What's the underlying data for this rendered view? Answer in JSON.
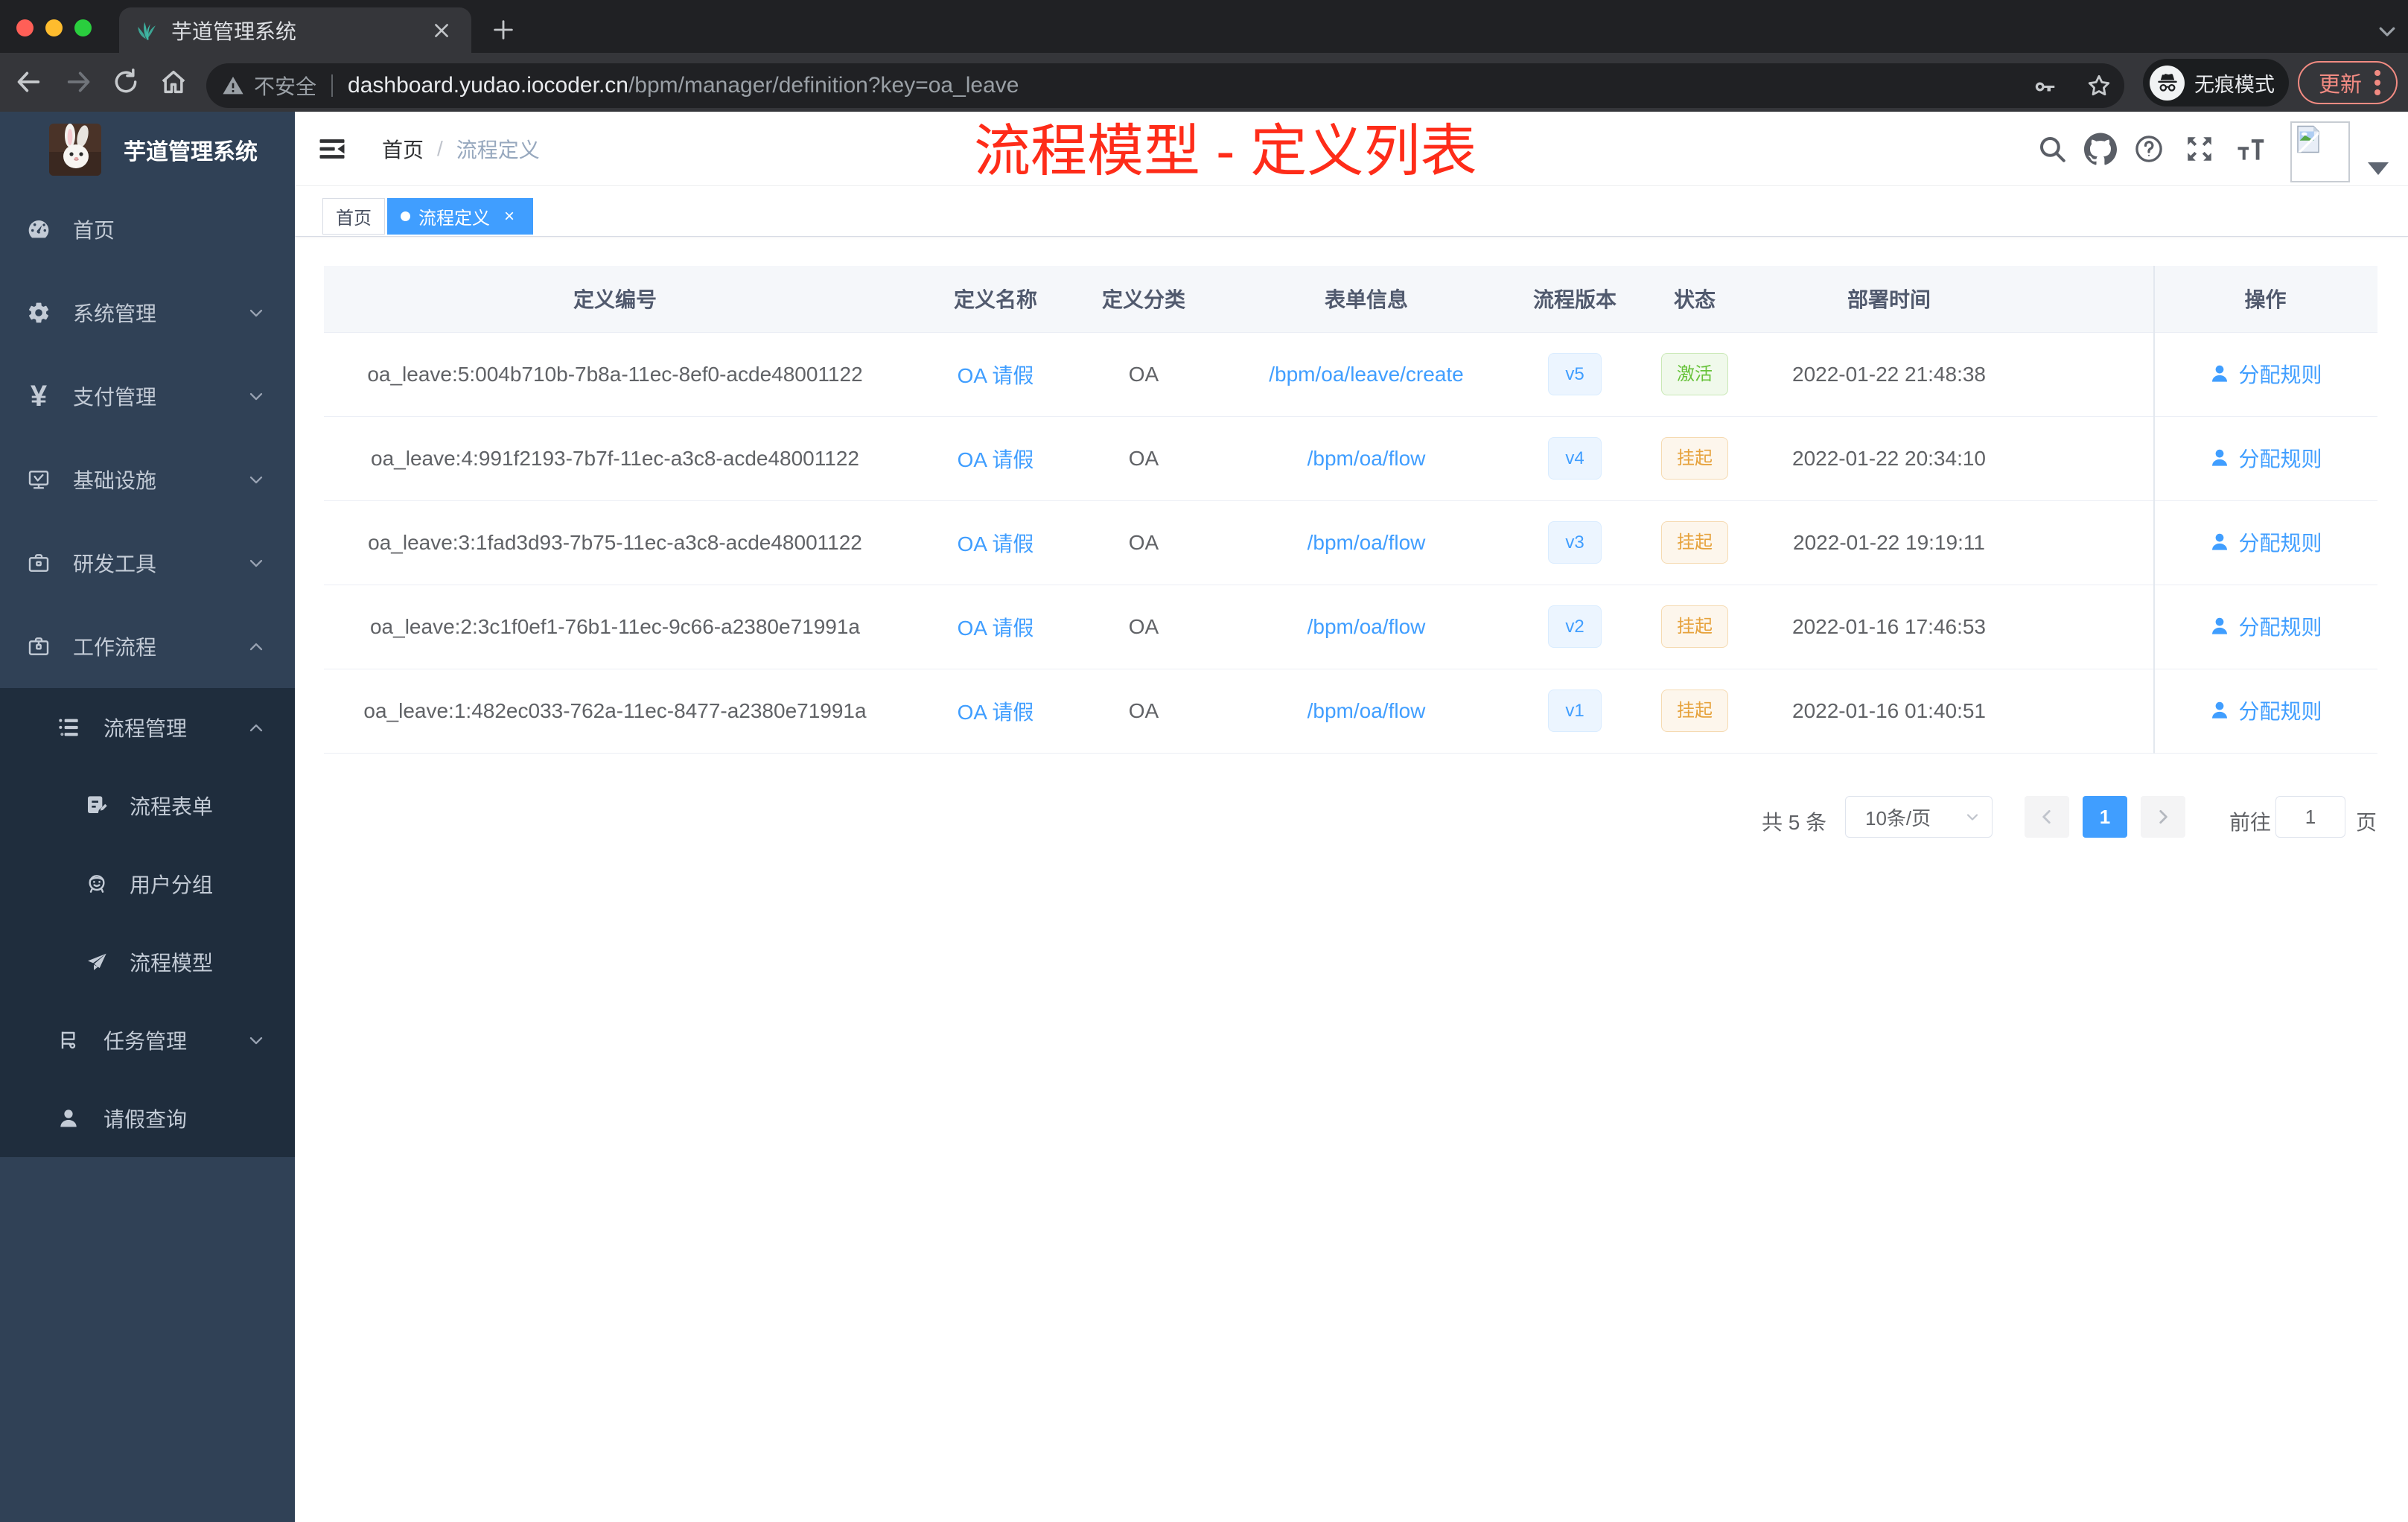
{
  "colors": {
    "accent": "#409eff",
    "success": "#67c23a",
    "warning": "#e6a23c",
    "annotation_red": "#fe2c19",
    "sidebar_bg": "#304156",
    "submenu_bg": "#1f2d3d",
    "update_pill": "#f28b82"
  },
  "browser": {
    "tab_title": "芋道管理系统",
    "new_tab": "+",
    "close_tab": "×",
    "url": {
      "security_label": "不安全",
      "domain": "dashboard.yudao.iocoder.cn",
      "path": "/bpm/manager/definition?key=oa_leave"
    },
    "incognito_label": "无痕模式",
    "update_label": "更新"
  },
  "sidebar": {
    "logo_title": "芋道管理系统",
    "menu": [
      {
        "label": "首页",
        "icon": "dashboard-icon"
      },
      {
        "label": "系统管理",
        "icon": "gear-icon",
        "arrow": "down"
      },
      {
        "label": "支付管理",
        "icon": "yen-icon",
        "arrow": "down",
        "icon_glyph": "¥"
      },
      {
        "label": "基础设施",
        "icon": "monitor-icon",
        "arrow": "down"
      },
      {
        "label": "研发工具",
        "icon": "toolbox-icon",
        "arrow": "down"
      },
      {
        "label": "工作流程",
        "icon": "workflow-icon",
        "arrow": "up"
      }
    ],
    "submenu": [
      {
        "label": "流程管理",
        "icon": "tree-table-icon",
        "arrow": "up",
        "level": 1
      },
      {
        "label": "流程表单",
        "icon": "form-edit-icon",
        "level": 2
      },
      {
        "label": "用户分组",
        "icon": "people-icon",
        "level": 2
      },
      {
        "label": "流程模型",
        "icon": "send-icon",
        "level": 2
      },
      {
        "label": "任务管理",
        "icon": "task-icon",
        "arrow": "down",
        "level": 1
      },
      {
        "label": "请假查询",
        "icon": "user-icon",
        "level": 1
      }
    ]
  },
  "navbar": {
    "breadcrumb": {
      "first": "首页",
      "separator": "/",
      "current": "流程定义"
    }
  },
  "annotation": {
    "text": "流程模型 - 定义列表",
    "color": "#fe2c19"
  },
  "tags": [
    {
      "label": "首页",
      "active": false
    },
    {
      "label": "流程定义",
      "active": true,
      "close": "×"
    }
  ],
  "table": {
    "columns": {
      "id": "定义编号",
      "name": "定义名称",
      "category": "定义分类",
      "form": "表单信息",
      "version": "流程版本",
      "status": "状态",
      "deployed": "部署时间",
      "action": "操作"
    },
    "rows": [
      {
        "id": "oa_leave:5:004b710b-7b8a-11ec-8ef0-acde48001122",
        "name": "OA 请假",
        "category": "OA",
        "form": "/bpm/oa/leave/create",
        "version": "v5",
        "status": "激活",
        "status_type": "success",
        "deployed": "2022-01-22 21:48:38",
        "action": "分配规则"
      },
      {
        "id": "oa_leave:4:991f2193-7b7f-11ec-a3c8-acde48001122",
        "name": "OA 请假",
        "category": "OA",
        "form": "/bpm/oa/flow",
        "version": "v4",
        "status": "挂起",
        "status_type": "warning",
        "deployed": "2022-01-22 20:34:10",
        "action": "分配规则"
      },
      {
        "id": "oa_leave:3:1fad3d93-7b75-11ec-a3c8-acde48001122",
        "name": "OA 请假",
        "category": "OA",
        "form": "/bpm/oa/flow",
        "version": "v3",
        "status": "挂起",
        "status_type": "warning",
        "deployed": "2022-01-22 19:19:11",
        "action": "分配规则"
      },
      {
        "id": "oa_leave:2:3c1f0ef1-76b1-11ec-9c66-a2380e71991a",
        "name": "OA 请假",
        "category": "OA",
        "form": "/bpm/oa/flow",
        "version": "v2",
        "status": "挂起",
        "status_type": "warning",
        "deployed": "2022-01-16 17:46:53",
        "action": "分配规则"
      },
      {
        "id": "oa_leave:1:482ec033-762a-11ec-8477-a2380e71991a",
        "name": "OA 请假",
        "category": "OA",
        "form": "/bpm/oa/flow",
        "version": "v1",
        "status": "挂起",
        "status_type": "warning",
        "deployed": "2022-01-16 01:40:51",
        "action": "分配规则"
      }
    ]
  },
  "pagination": {
    "total_label": "共 5 条",
    "page_size": "10条/页",
    "current_page": "1",
    "goto_label": "前往",
    "goto_value": "1",
    "page_unit": "页"
  }
}
